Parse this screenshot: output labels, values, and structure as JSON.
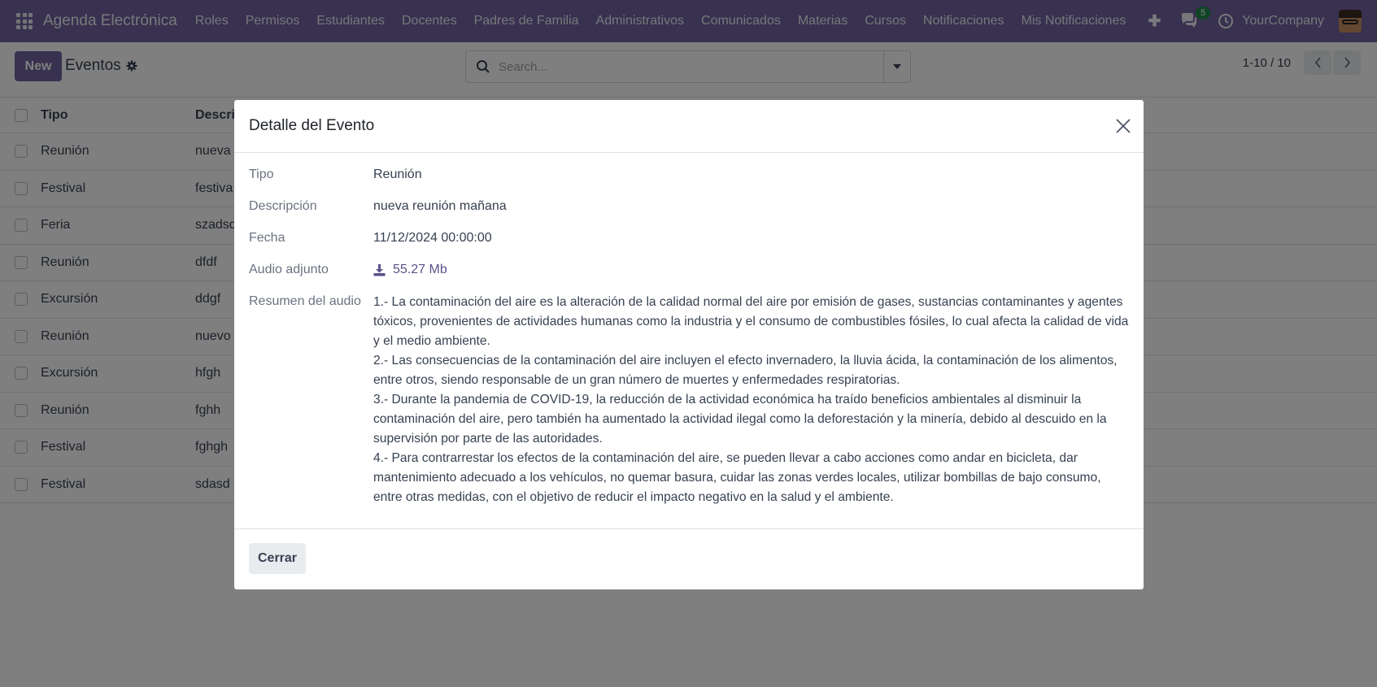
{
  "app": {
    "title": "Agenda Electrónica",
    "company": "YourCompany"
  },
  "menu": [
    {
      "label": "Roles"
    },
    {
      "label": "Permisos"
    },
    {
      "label": "Estudiantes"
    },
    {
      "label": "Docentes"
    },
    {
      "label": "Padres de Familia"
    },
    {
      "label": "Administrativos"
    },
    {
      "label": "Comunicados"
    },
    {
      "label": "Materias"
    },
    {
      "label": "Cursos"
    },
    {
      "label": "Notificaciones"
    },
    {
      "label": "Mis Notificaciones"
    }
  ],
  "systray": {
    "chat_badge": "5"
  },
  "control": {
    "new_label": "New",
    "view_title": "Eventos",
    "search_placeholder": "Search...",
    "pager": "1-10 / 10"
  },
  "list": {
    "headers": {
      "tipo": "Tipo",
      "descripcion": "Descripción"
    },
    "rows": [
      {
        "tipo": "Reunión",
        "descripcion": "nueva"
      },
      {
        "tipo": "Festival",
        "descripcion": "festiva"
      },
      {
        "tipo": "Feria",
        "descripcion": "szadsd"
      },
      {
        "tipo": "Reunión",
        "descripcion": "dfdf"
      },
      {
        "tipo": "Excursión",
        "descripcion": "ddgf"
      },
      {
        "tipo": "Reunión",
        "descripcion": "nuevo"
      },
      {
        "tipo": "Excursión",
        "descripcion": "hfgh"
      },
      {
        "tipo": "Reunión",
        "descripcion": "fghh"
      },
      {
        "tipo": "Festival",
        "descripcion": "fghgh"
      },
      {
        "tipo": "Festival",
        "descripcion": "sdasd"
      }
    ]
  },
  "modal": {
    "title": "Detalle del Evento",
    "fields": {
      "tipo": {
        "label": "Tipo",
        "value": "Reunión"
      },
      "descripcion": {
        "label": "Descripción",
        "value": "nueva reunión mañana"
      },
      "fecha": {
        "label": "Fecha",
        "value": "11/12/2024 00:00:00"
      },
      "audio": {
        "label": "Audio adjunto",
        "value": "55.27 Mb"
      },
      "resumen": {
        "label": "Resumen del audio",
        "paragraphs": [
          "1.- La contaminación del aire es la alteración de la calidad normal del aire por emisión de gases, sustancias contaminantes y agentes tóxicos, provenientes de actividades humanas como la industria y el consumo de combustibles fósiles, lo cual afecta la calidad de vida y el medio ambiente.",
          "2.- Las consecuencias de la contaminación del aire incluyen el efecto invernadero, la lluvia ácida, la contaminación de los alimentos, entre otros, siendo responsable de un gran número de muertes y enfermedades respiratorias.",
          "3.- Durante la pandemia de COVID-19, la reducción de la actividad económica ha traído beneficios ambientales al disminuir la contaminación del aire, pero también ha aumentado la actividad ilegal como la deforestación y la minería, debido al descuido en la supervisión por parte de las autoridades.",
          "4.- Para contrarrestar los efectos de la contaminación del aire, se pueden llevar a cabo acciones como andar en bicicleta, dar mantenimiento adecuado a los vehículos, no quemar basura, cuidar las zonas verdes locales, utilizar bombillas de bajo consumo, entre otras medidas, con el objetivo de reducir el impacto negativo en la salud y el ambiente."
        ]
      }
    },
    "close_label": "Cerrar"
  },
  "colors": {
    "brand": "#71639e",
    "overlay": "rgba(0,0,0,0.5)"
  }
}
